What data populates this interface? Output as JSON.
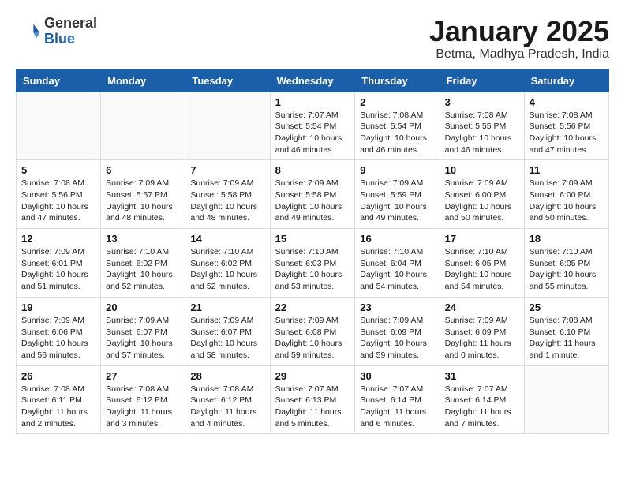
{
  "header": {
    "logo_general": "General",
    "logo_blue": "Blue",
    "month_title": "January 2025",
    "subtitle": "Betma, Madhya Pradesh, India"
  },
  "days_of_week": [
    "Sunday",
    "Monday",
    "Tuesday",
    "Wednesday",
    "Thursday",
    "Friday",
    "Saturday"
  ],
  "weeks": [
    [
      {
        "day": "",
        "info": ""
      },
      {
        "day": "",
        "info": ""
      },
      {
        "day": "",
        "info": ""
      },
      {
        "day": "1",
        "info": "Sunrise: 7:07 AM\nSunset: 5:54 PM\nDaylight: 10 hours\nand 46 minutes."
      },
      {
        "day": "2",
        "info": "Sunrise: 7:08 AM\nSunset: 5:54 PM\nDaylight: 10 hours\nand 46 minutes."
      },
      {
        "day": "3",
        "info": "Sunrise: 7:08 AM\nSunset: 5:55 PM\nDaylight: 10 hours\nand 46 minutes."
      },
      {
        "day": "4",
        "info": "Sunrise: 7:08 AM\nSunset: 5:56 PM\nDaylight: 10 hours\nand 47 minutes."
      }
    ],
    [
      {
        "day": "5",
        "info": "Sunrise: 7:08 AM\nSunset: 5:56 PM\nDaylight: 10 hours\nand 47 minutes."
      },
      {
        "day": "6",
        "info": "Sunrise: 7:09 AM\nSunset: 5:57 PM\nDaylight: 10 hours\nand 48 minutes."
      },
      {
        "day": "7",
        "info": "Sunrise: 7:09 AM\nSunset: 5:58 PM\nDaylight: 10 hours\nand 48 minutes."
      },
      {
        "day": "8",
        "info": "Sunrise: 7:09 AM\nSunset: 5:58 PM\nDaylight: 10 hours\nand 49 minutes."
      },
      {
        "day": "9",
        "info": "Sunrise: 7:09 AM\nSunset: 5:59 PM\nDaylight: 10 hours\nand 49 minutes."
      },
      {
        "day": "10",
        "info": "Sunrise: 7:09 AM\nSunset: 6:00 PM\nDaylight: 10 hours\nand 50 minutes."
      },
      {
        "day": "11",
        "info": "Sunrise: 7:09 AM\nSunset: 6:00 PM\nDaylight: 10 hours\nand 50 minutes."
      }
    ],
    [
      {
        "day": "12",
        "info": "Sunrise: 7:09 AM\nSunset: 6:01 PM\nDaylight: 10 hours\nand 51 minutes."
      },
      {
        "day": "13",
        "info": "Sunrise: 7:10 AM\nSunset: 6:02 PM\nDaylight: 10 hours\nand 52 minutes."
      },
      {
        "day": "14",
        "info": "Sunrise: 7:10 AM\nSunset: 6:02 PM\nDaylight: 10 hours\nand 52 minutes."
      },
      {
        "day": "15",
        "info": "Sunrise: 7:10 AM\nSunset: 6:03 PM\nDaylight: 10 hours\nand 53 minutes."
      },
      {
        "day": "16",
        "info": "Sunrise: 7:10 AM\nSunset: 6:04 PM\nDaylight: 10 hours\nand 54 minutes."
      },
      {
        "day": "17",
        "info": "Sunrise: 7:10 AM\nSunset: 6:05 PM\nDaylight: 10 hours\nand 54 minutes."
      },
      {
        "day": "18",
        "info": "Sunrise: 7:10 AM\nSunset: 6:05 PM\nDaylight: 10 hours\nand 55 minutes."
      }
    ],
    [
      {
        "day": "19",
        "info": "Sunrise: 7:09 AM\nSunset: 6:06 PM\nDaylight: 10 hours\nand 56 minutes."
      },
      {
        "day": "20",
        "info": "Sunrise: 7:09 AM\nSunset: 6:07 PM\nDaylight: 10 hours\nand 57 minutes."
      },
      {
        "day": "21",
        "info": "Sunrise: 7:09 AM\nSunset: 6:07 PM\nDaylight: 10 hours\nand 58 minutes."
      },
      {
        "day": "22",
        "info": "Sunrise: 7:09 AM\nSunset: 6:08 PM\nDaylight: 10 hours\nand 59 minutes."
      },
      {
        "day": "23",
        "info": "Sunrise: 7:09 AM\nSunset: 6:09 PM\nDaylight: 10 hours\nand 59 minutes."
      },
      {
        "day": "24",
        "info": "Sunrise: 7:09 AM\nSunset: 6:09 PM\nDaylight: 11 hours\nand 0 minutes."
      },
      {
        "day": "25",
        "info": "Sunrise: 7:08 AM\nSunset: 6:10 PM\nDaylight: 11 hours\nand 1 minute."
      }
    ],
    [
      {
        "day": "26",
        "info": "Sunrise: 7:08 AM\nSunset: 6:11 PM\nDaylight: 11 hours\nand 2 minutes."
      },
      {
        "day": "27",
        "info": "Sunrise: 7:08 AM\nSunset: 6:12 PM\nDaylight: 11 hours\nand 3 minutes."
      },
      {
        "day": "28",
        "info": "Sunrise: 7:08 AM\nSunset: 6:12 PM\nDaylight: 11 hours\nand 4 minutes."
      },
      {
        "day": "29",
        "info": "Sunrise: 7:07 AM\nSunset: 6:13 PM\nDaylight: 11 hours\nand 5 minutes."
      },
      {
        "day": "30",
        "info": "Sunrise: 7:07 AM\nSunset: 6:14 PM\nDaylight: 11 hours\nand 6 minutes."
      },
      {
        "day": "31",
        "info": "Sunrise: 7:07 AM\nSunset: 6:14 PM\nDaylight: 11 hours\nand 7 minutes."
      },
      {
        "day": "",
        "info": ""
      }
    ]
  ]
}
